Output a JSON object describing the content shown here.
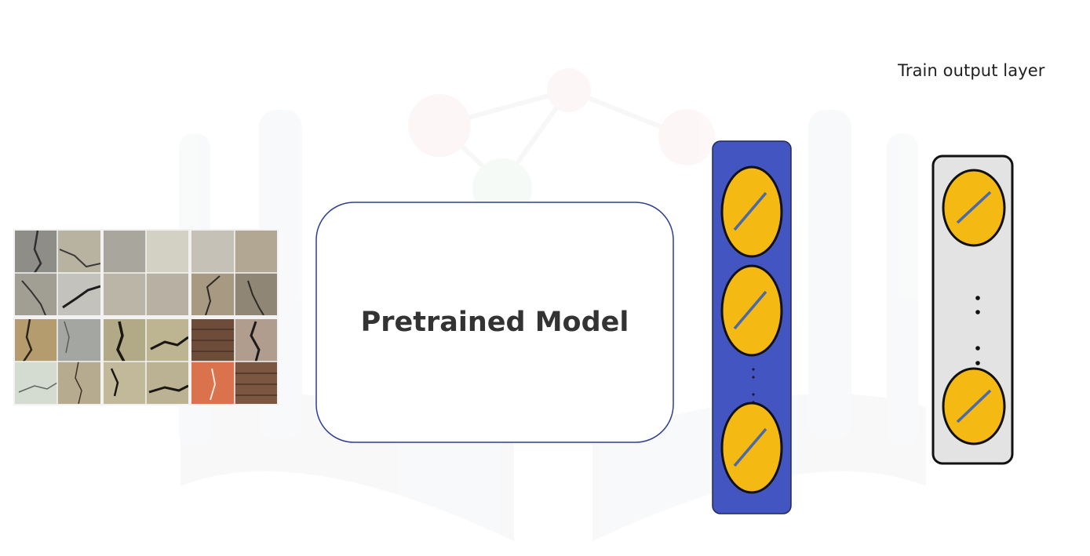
{
  "labels": {
    "pretrained_model": "Pretrained Model",
    "output_layer_title": "Train output layer"
  },
  "colors": {
    "background": "#ffffff",
    "model_box_border": "#2f3f8f",
    "hidden_layer_fill": "#4355c0",
    "output_layer_fill": "#e3e3e3",
    "neuron_fill": "#f5b914",
    "neuron_stroke": "#111111",
    "neuron_slash": "#4a6aa8",
    "watermark": "#f1f2f3"
  },
  "icons": {
    "neuron": "neuron-linear-activation-icon",
    "ellipsis": "vertical-ellipsis-icon",
    "input": "crack-image-grid",
    "watermark": "faded-logo-watermark"
  },
  "input_images": {
    "grid": "3x2 panels of 2x2 concrete texture tiles"
  }
}
